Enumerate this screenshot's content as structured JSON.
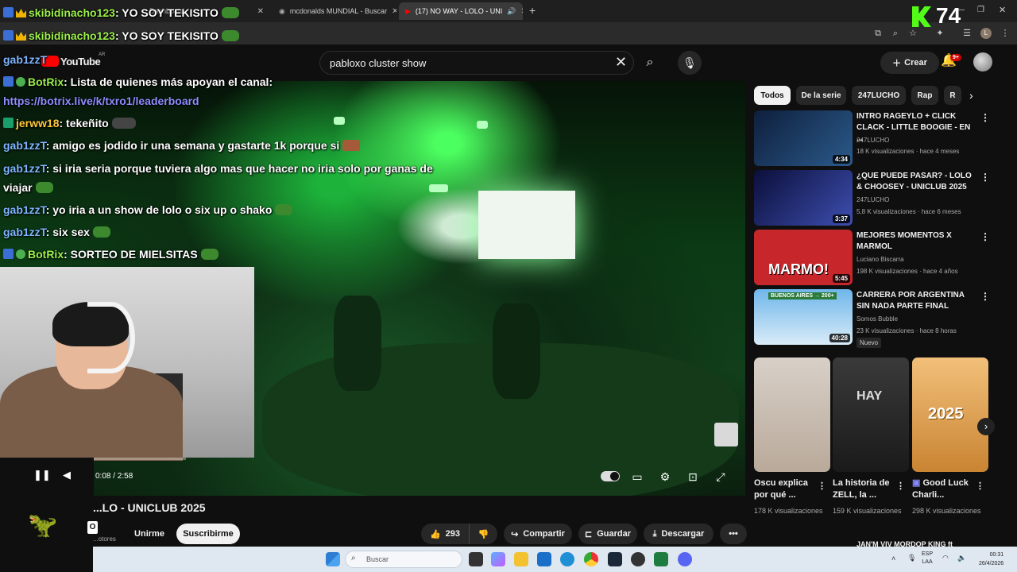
{
  "browser": {
    "tabs": [
      {
        "label": "Dashboard",
        "active": false
      },
      {
        "label": "mcdonalds MUNDIAL - Buscar",
        "active": false
      },
      {
        "label": "(17) NO WAY - LOLO - UNI",
        "active": true
      }
    ],
    "new_tab": "+"
  },
  "stream_overlay": {
    "kick_count": "74",
    "top_messages": [
      {
        "user": "skibidinacho123",
        "text": ": YO SOY TEKISITO"
      },
      {
        "user": "skibidinacho123",
        "text": ": YO SOY TEKISITO"
      }
    ],
    "chat": [
      {
        "user": "gab1zzT",
        "text": "",
        "user_class": "user-blue"
      },
      {
        "user": "BotRix",
        "text": ": Lista de quienes más apoyan el canal:",
        "user_class": "user-green"
      },
      {
        "user": "",
        "text": "https://botrix.live/k/txro1/leaderboard",
        "user_class": "link"
      },
      {
        "user": "jerww18",
        "text": ": tekeñito",
        "user_class": "user-yellow"
      },
      {
        "user": "gab1zzT",
        "text": ": amigo es jodido ir una semana y gastarte 1k porque si",
        "user_class": "user-blue"
      },
      {
        "user": "gab1zzT",
        "text": ": si iria seria porque tuviera algo mas que hacer no iria solo por ganas de",
        "user_class": "user-blue"
      },
      {
        "user": "",
        "text": "viajar",
        "user_class": ""
      },
      {
        "user": "gab1zzT",
        "text": ": yo iria a un show de lolo o six up o shako",
        "user_class": "user-blue"
      },
      {
        "user": "gab1zzT",
        "text": ": six sex",
        "user_class": "user-blue"
      },
      {
        "user": "BotRix",
        "text": ": SORTEO DE MIELSITAS",
        "user_class": "user-green"
      }
    ]
  },
  "youtube": {
    "logo": "YouTube",
    "logo_region": "AR",
    "search": {
      "value": "pabloxo cluster show",
      "placeholder": "Buscar"
    },
    "create_label": "Crear",
    "notif_badge": "9+",
    "player": {
      "time": "0:08 / 2:58",
      "progress": 0.045
    },
    "video_title": "...LO - UNICLUB 2025",
    "channel_sub_text": "...otores",
    "channel_badge": "O",
    "unsubscribe_label": "Unirme",
    "subscribe_label": "Suscribirme",
    "like_count": "293",
    "share_label": "Compartir",
    "save_label": "Guardar",
    "download_label": "Descargar",
    "chips": [
      "Todos",
      "De la serie",
      "247LUCHO",
      "Rap",
      "R"
    ],
    "recommendations": [
      {
        "title": "INTRO RAGEYLO + CLICK CLACK - LITTLE BOOGIE - EN ...",
        "channel": "247LUCHO",
        "meta": "18 K visualizaciones · hace 4 meses",
        "duration": "4:34",
        "thumb_color": "#1b3a5c"
      },
      {
        "title": "¿QUE PUEDE PASAR? - LOLO & CHOOSEY - UNICLUB 2025",
        "channel": "247LUCHO",
        "meta": "5,8 K visualizaciones · hace 6 meses",
        "duration": "3:37",
        "thumb_color": "#1f2a6b"
      },
      {
        "title": "MEJORES MOMENTOS X MARMOL",
        "channel": "Luciano Biscarra",
        "meta": "198 K visualizaciones · hace 4 años",
        "duration": "5:45",
        "thumb_color": "#c7262b",
        "thumb_text": "MARMO!"
      },
      {
        "title": "CARRERA POR ARGENTINA SIN NADA PARTE FINAL",
        "channel": "Somos Bubble",
        "meta": "23 K visualizaciones · hace 8 horas",
        "duration": "40:28",
        "thumb_color": "#5aa0d8",
        "badge": "Nuevo",
        "thumb_text": "BUENOS AIRES → 200+"
      }
    ],
    "shorts": [
      {
        "title": "Oscu explica por qué ...",
        "views": "178 K visualizaciones",
        "thumb_color": "#cfc7bf"
      },
      {
        "title": "La historia de ZELL, la ...",
        "views": "159 K visualizaciones",
        "thumb_color": "#2a2a2a",
        "thumb_text": "HAY"
      },
      {
        "title": "Good Luck Charli...",
        "views": "298 K visualizaciones",
        "thumb_color": "#e09a3c",
        "thumb_text": "2025"
      }
    ],
    "next_rec_peek": "JAN'M VIV  MORDOP KING ft"
  },
  "taskbar": {
    "search_placeholder": "Buscar",
    "lang": "ESP\nLAA",
    "time": "00:31",
    "date": "26/4/2026"
  }
}
